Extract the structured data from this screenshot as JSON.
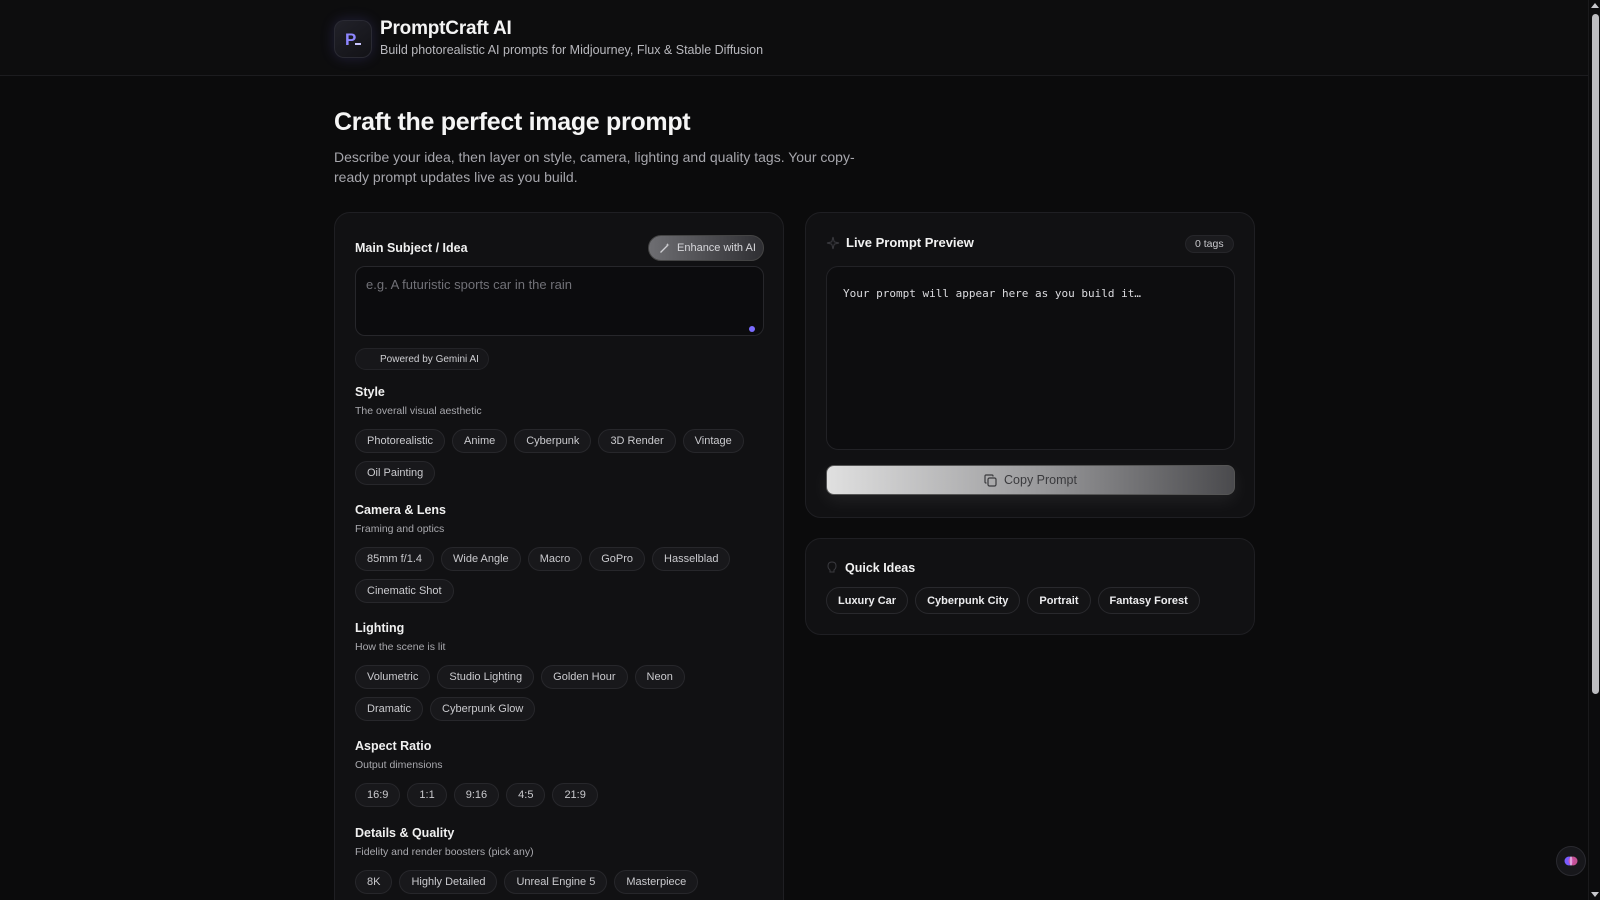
{
  "app": {
    "title": "PromptCraft AI",
    "subtitle": "Build photorealistic AI prompts for Midjourney, Flux & Stable Diffusion",
    "logo_letter": "P"
  },
  "hero": {
    "title": "Craft the perfect image prompt",
    "description": "Describe your idea, then layer on style, camera, lighting and quality tags. Your copy-ready prompt updates live as you build."
  },
  "subject": {
    "label": "Main Subject / Idea",
    "enhance_label": "Enhance with AI",
    "placeholder": "e.g. A futuristic sports car in the rain",
    "value": "",
    "powered_by": "Powered by Gemini AI"
  },
  "sections": {
    "style": {
      "title": "Style",
      "subtitle": "The overall visual aesthetic",
      "options": [
        "Photorealistic",
        "Anime",
        "Cyberpunk",
        "3D Render",
        "Vintage",
        "Oil Painting"
      ]
    },
    "camera": {
      "title": "Camera & Lens",
      "subtitle": "Framing and optics",
      "options": [
        "85mm f/1.4",
        "Wide Angle",
        "Macro",
        "GoPro",
        "Hasselblad",
        "Cinematic Shot"
      ]
    },
    "lighting": {
      "title": "Lighting",
      "subtitle": "How the scene is lit",
      "options": [
        "Volumetric",
        "Studio Lighting",
        "Golden Hour",
        "Neon",
        "Dramatic",
        "Cyberpunk Glow"
      ]
    },
    "aspect": {
      "title": "Aspect Ratio",
      "subtitle": "Output dimensions",
      "options": [
        "16:9",
        "1:1",
        "9:16",
        "4:5",
        "21:9"
      ]
    },
    "details": {
      "title": "Details & Quality",
      "subtitle": "Fidelity and render boosters (pick any)",
      "options": [
        "8K",
        "Highly Detailed",
        "Unreal Engine 5",
        "Masterpiece"
      ]
    }
  },
  "preview": {
    "title": "Live Prompt Preview",
    "tag_count": "0 tags",
    "placeholder": "Your prompt will appear here as you build it…",
    "copy_label": "Copy Prompt"
  },
  "quick_ideas": {
    "title": "Quick Ideas",
    "items": [
      "Luxury Car",
      "Cyberpunk City",
      "Portrait",
      "Fantasy Forest"
    ]
  },
  "colors": {
    "background": "#0b0b0c",
    "panel": "#111113",
    "accent": "#7b6cff"
  }
}
